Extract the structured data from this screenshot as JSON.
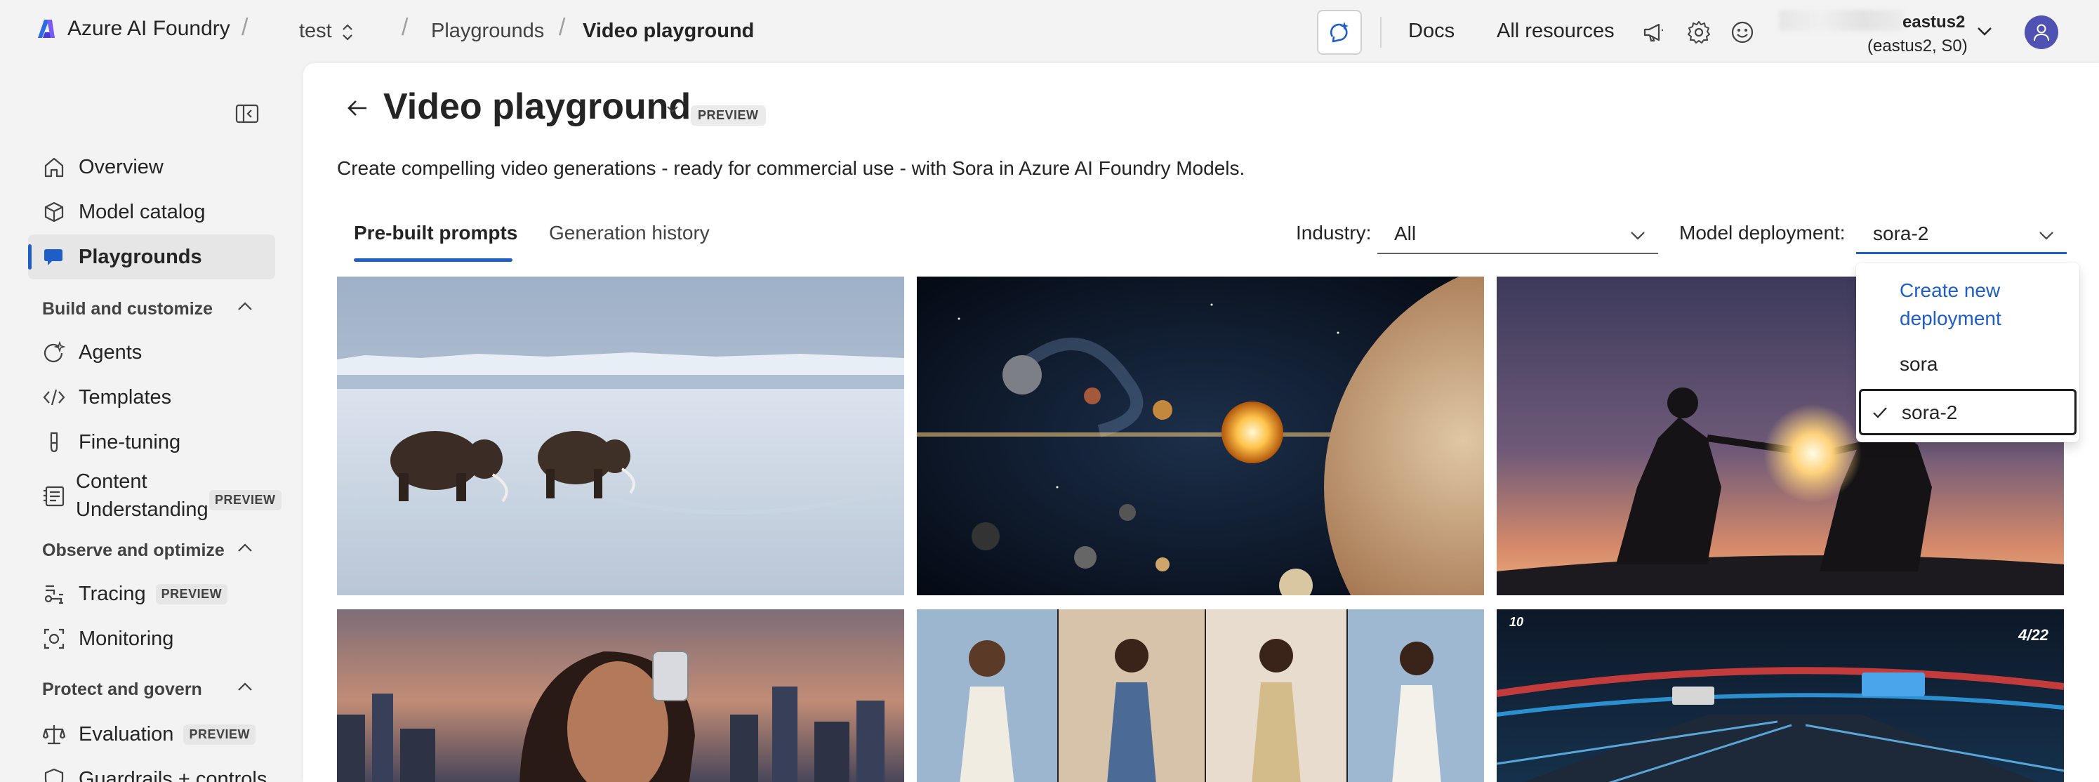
{
  "topbar": {
    "brand": "Azure AI Foundry",
    "project": "test",
    "breadcrumbs": [
      "Playgrounds",
      "Video playground"
    ],
    "links": {
      "docs": "Docs",
      "all_resources": "All resources"
    },
    "account": {
      "region": "eastus2",
      "sub": "(eastus2, S0)"
    }
  },
  "sidebar": {
    "items": [
      {
        "label": "Overview",
        "icon": "home-icon"
      },
      {
        "label": "Model catalog",
        "icon": "cube-icon"
      },
      {
        "label": "Playgrounds",
        "icon": "chat-icon",
        "active": true
      }
    ],
    "sections": [
      {
        "title": "Build and customize",
        "items": [
          {
            "label": "Agents",
            "icon": "agent-icon"
          },
          {
            "label": "Templates",
            "icon": "code-icon"
          },
          {
            "label": "Fine-tuning",
            "icon": "flask-icon"
          },
          {
            "label_line1": "Content",
            "label_line2": "Understanding",
            "icon": "document-icon",
            "badge": "PREVIEW"
          }
        ]
      },
      {
        "title": "Observe and optimize",
        "items": [
          {
            "label": "Tracing",
            "icon": "tracing-icon",
            "badge": "PREVIEW"
          },
          {
            "label": "Monitoring",
            "icon": "monitoring-icon"
          }
        ]
      },
      {
        "title": "Protect and govern",
        "items": [
          {
            "label": "Evaluation",
            "icon": "scale-icon",
            "badge": "PREVIEW"
          },
          {
            "label": "Guardrails + controls",
            "icon": "shield-icon"
          }
        ]
      }
    ]
  },
  "main": {
    "title": "Video playground",
    "badge": "PREVIEW",
    "description": "Create compelling video generations - ready for commercial use - with Sora in Azure AI Foundry Models.",
    "tabs": [
      {
        "label": "Pre-built prompts",
        "active": true
      },
      {
        "label": "Generation history",
        "active": false
      }
    ],
    "filters": {
      "industry_label": "Industry:",
      "industry_value": "All",
      "deployment_label": "Model deployment:",
      "deployment_value": "sora-2"
    },
    "deployment_options": [
      {
        "label": "Create new deployment",
        "line1": "Create new",
        "line2": "deployment"
      },
      {
        "label": "sora"
      },
      {
        "label": "sora-2",
        "selected": true
      }
    ],
    "tiles": [
      {
        "subject": "mammoths walking on snowy tundra"
      },
      {
        "subject": "solar system with planets"
      },
      {
        "subject": "samurai duel at sunset"
      },
      {
        "subject": "woman with perfume bottle over city skyline"
      },
      {
        "subject": "fashion models in four panels"
      },
      {
        "subject": "racing game with neon track",
        "hud_left": "10",
        "hud_right": "4/22"
      }
    ]
  },
  "colors": {
    "accent": "#1f5ec9",
    "avatar": "#4f52b2",
    "background": "#f3f3f3"
  }
}
